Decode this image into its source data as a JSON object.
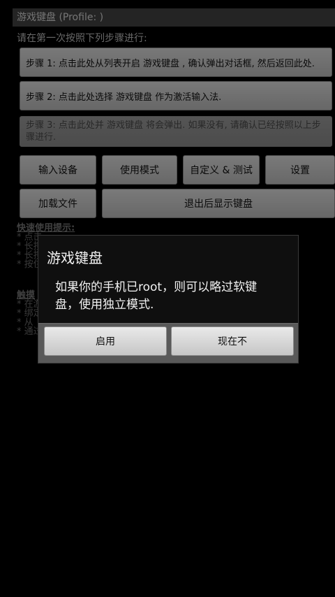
{
  "title_bar": "游戏键盘 (Profile: )",
  "subtitle": "请在第一次按照下列步骤进行:",
  "steps": [
    "步骤 1: 点击此处从列表开启 游戏键盘 , 确认弹出对话框, 然后返回此处.",
    "步骤 2: 点击此处选择 游戏键盘 作为激活输入法.",
    "步骤 3: 点击此处并 游戏键盘 将会弹出. 如果没有, 请确认已经按照以上步骤进行."
  ],
  "buttons_row1": [
    "输入设备",
    "使用模式",
    "自定义 & 测试",
    "设置"
  ],
  "buttons_row2": [
    "加载文件",
    "退出后显示键盘"
  ],
  "tips_quick": {
    "heading": "快速使用提示:",
    "lines": [
      "* 点击",
      "* 长按",
      "* 长按",
      "* 按住"
    ]
  },
  "tips_touch": {
    "heading": "触摸",
    "lines": [
      "* 在游",
      "* 绑定",
      "* 从",
      "* 通过"
    ]
  },
  "dialog": {
    "title": "游戏键盘",
    "message": "如果你的手机已root，则可以略过软键盘，使用独立模式.",
    "positive": "启用",
    "negative": "现在不"
  }
}
